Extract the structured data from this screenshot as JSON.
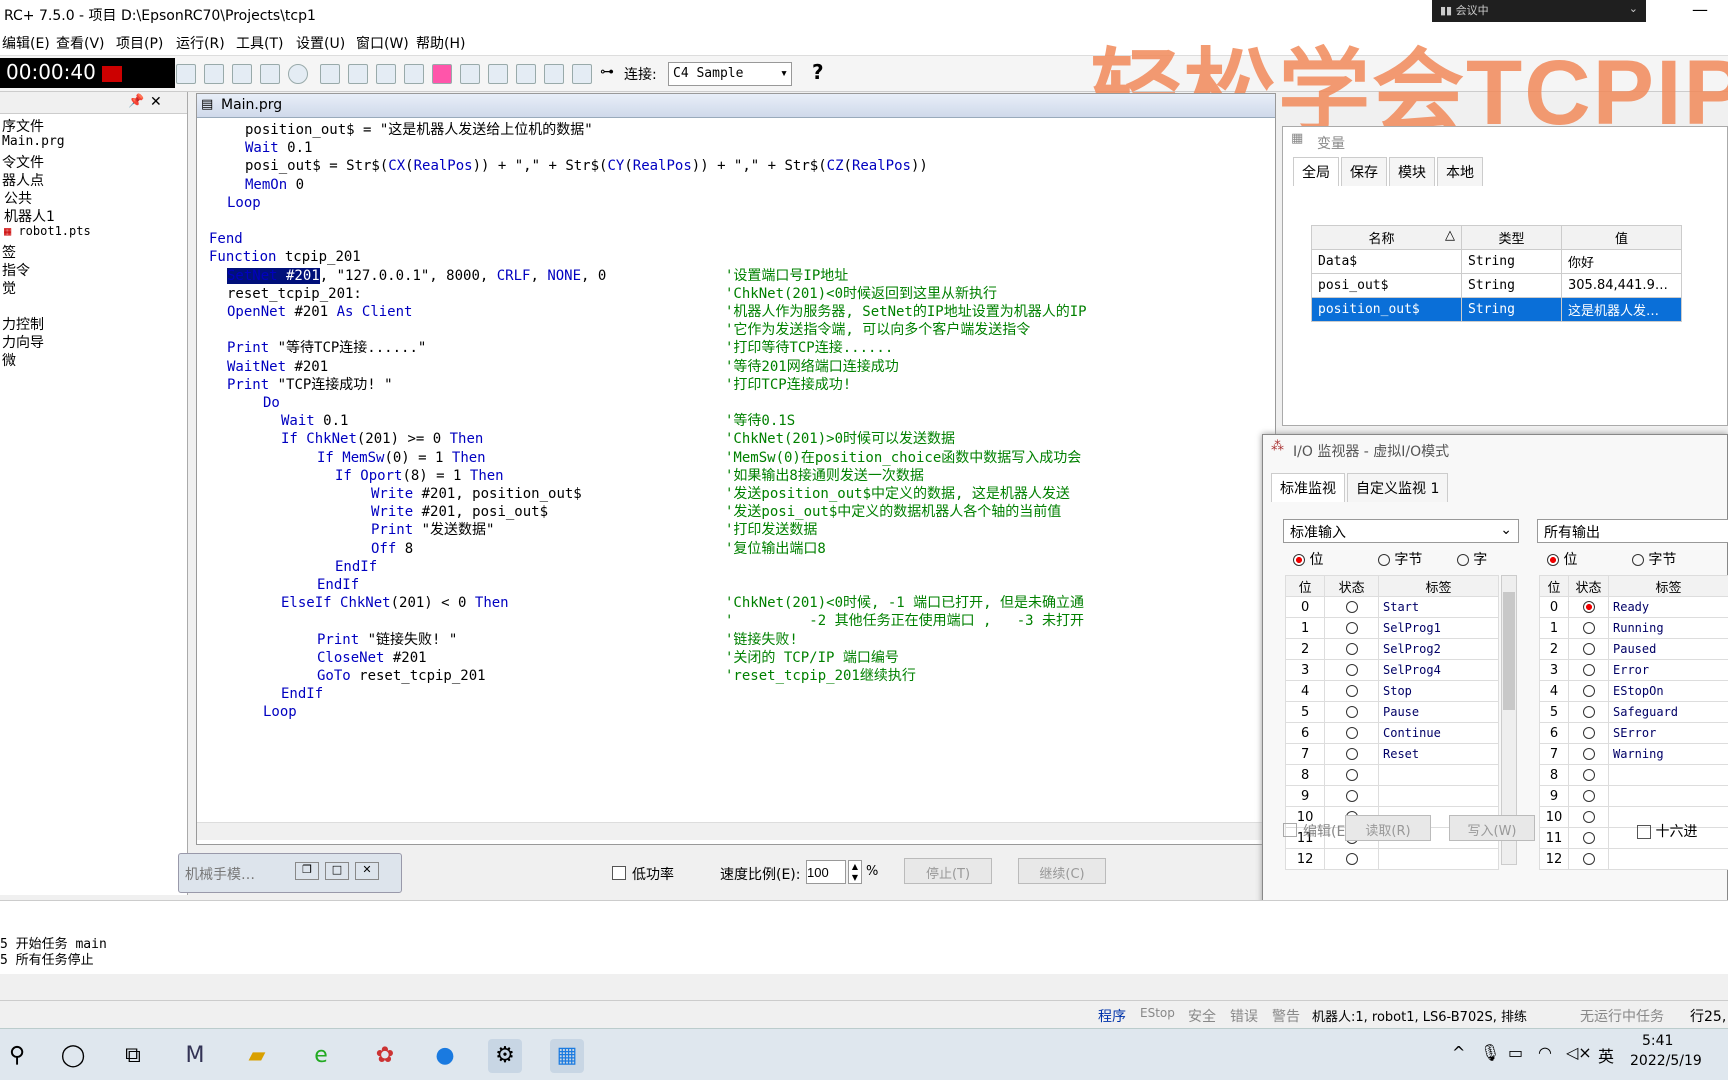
{
  "window": {
    "title": "RC+ 7.5.0 - 项目 D:\\EpsonRC70\\Projects\\tcp1",
    "timer": "00:00:40",
    "meeting": "会议中",
    "minimize": "—"
  },
  "watermark": "轻松学会TCPIP",
  "menu": [
    "编辑(E)",
    "查看(V)",
    "项目(P)",
    "运行(R)",
    "工具(T)",
    "设置(U)",
    "窗口(W)",
    "帮助(H)"
  ],
  "toolbar": {
    "connect_label": "连接:",
    "connect_value": "C4 Sample",
    "help": "?"
  },
  "project_tree": {
    "pin": "📌",
    "close": "✕",
    "items": [
      "序文件",
      "Main.prg",
      "令文件",
      "器人点",
      "公共",
      "机器人1",
      "robot1.pts",
      "签",
      "指令",
      "觉",
      "",
      "力控制",
      "力向导",
      "微"
    ]
  },
  "editor": {
    "tab": "Main.prg",
    "lines": [
      {
        "i": 1,
        "t": "position_out$ = \"这是机器人发送给上位机的数据\"",
        "c": ""
      },
      {
        "i": 1,
        "t": "Wait 0.1",
        "c": ""
      },
      {
        "i": 1,
        "t": "posi_out$ = Str$(CX(RealPos)) + \",\" + Str$(CY(RealPos)) + \",\" + Str$(CZ(RealPos))",
        "c": ""
      },
      {
        "i": 1,
        "t": "MemOn 0",
        "c": ""
      },
      {
        "i": 0.5,
        "t": "Loop",
        "c": ""
      },
      {
        "i": 0,
        "t": "",
        "c": ""
      },
      {
        "i": 0,
        "t": "Fend",
        "c": ""
      },
      {
        "i": 0,
        "t": "Function tcpip_201",
        "c": ""
      },
      {
        "i": 0.5,
        "t": "SetNet #201, \"127.0.0.1\", 8000, CRLF, NONE, 0",
        "c": "'设置端口号IP地址"
      },
      {
        "i": 0.5,
        "t": "reset_tcpip_201:",
        "c": "'ChkNet(201)<0时候返回到这里从新执行"
      },
      {
        "i": 0.5,
        "t": "OpenNet #201 As Client",
        "c": "'机器人作为服务器, SetNet的IP地址设置为机器人的IP"
      },
      {
        "i": 0,
        "t": "",
        "c": "'它作为发送指令端, 可以向多个客户端发送指令"
      },
      {
        "i": 0.5,
        "t": "Print \"等待TCP连接......\"",
        "c": "'打印等待TCP连接......"
      },
      {
        "i": 0.5,
        "t": "WaitNet #201",
        "c": "'等待201网络端口连接成功"
      },
      {
        "i": 0.5,
        "t": "Print \"TCP连接成功! \"",
        "c": "'打印TCP连接成功!"
      },
      {
        "i": 1.5,
        "t": "Do",
        "c": ""
      },
      {
        "i": 2,
        "t": "Wait 0.1",
        "c": "'等待0.1S"
      },
      {
        "i": 2,
        "t": "If ChkNet(201) >= 0 Then",
        "c": "'ChkNet(201)>0时候可以发送数据"
      },
      {
        "i": 3,
        "t": "If MemSw(0) = 1 Then",
        "c": "'MemSw(0)在position_choice函数中数据写入成功会"
      },
      {
        "i": 3.5,
        "t": "If Oport(8) = 1 Then",
        "c": "'如果输出8接通则发送一次数据"
      },
      {
        "i": 4.5,
        "t": "Write #201, position_out$",
        "c": "'发送position_out$中定义的数据, 这是机器人发送"
      },
      {
        "i": 4.5,
        "t": "Write #201, posi_out$",
        "c": "'发送posi_out$中定义的数据机器人各个轴的当前值"
      },
      {
        "i": 4.5,
        "t": "Print \"发送数据\"",
        "c": "'打印发送数据"
      },
      {
        "i": 4.5,
        "t": "Off 8",
        "c": "'复位输出端口8"
      },
      {
        "i": 3.5,
        "t": "EndIf",
        "c": ""
      },
      {
        "i": 3,
        "t": "EndIf",
        "c": ""
      },
      {
        "i": 2,
        "t": "ElseIf ChkNet(201) < 0 Then",
        "c": "'ChkNet(201)<0时候, -1 端口已打开, 但是未确立通"
      },
      {
        "i": 0,
        "t": "",
        "c": "'         -2 其他任务正在使用端口 ,   -3 未打开"
      },
      {
        "i": 3,
        "t": "Print \"链接失败! \"",
        "c": "'链接失败!"
      },
      {
        "i": 3,
        "t": "CloseNet #201",
        "c": "'关闭的 TCP/IP 端口编号"
      },
      {
        "i": 3,
        "t": "GoTo reset_tcpip_201",
        "c": "'reset_tcpip_201继续执行"
      },
      {
        "i": 2,
        "t": "EndIf",
        "c": ""
      },
      {
        "i": 1.5,
        "t": "Loop",
        "c": ""
      }
    ]
  },
  "robot_panel": {
    "title": "机械手模…",
    "low_power": "低功率",
    "speed_label": "速度比例(E):",
    "speed_value": "100",
    "speed_unit": "%",
    "stop": "停止(T)",
    "continue": "继续(C)"
  },
  "variables": {
    "title": "变量",
    "tabs": [
      "全局",
      "保存",
      "模块",
      "本地"
    ],
    "headers": [
      "名称",
      "类型",
      "值"
    ],
    "rows": [
      {
        "name": "Data$",
        "type": "String",
        "value": "你好"
      },
      {
        "name": "posi_out$",
        "type": "String",
        "value": "305.84,441.9…"
      },
      {
        "name": "position_out$",
        "type": "String",
        "value": "这是机器人发…"
      }
    ]
  },
  "io_monitor": {
    "title": "I/O 监视器 - 虚拟I/O模式",
    "tabs": [
      "标准监视",
      "自定义监视 1"
    ],
    "input_select": "标准输入",
    "output_select": "所有输出",
    "radio": [
      "位",
      "字节",
      "字"
    ],
    "headers": [
      "位",
      "状态",
      "标签"
    ],
    "inputs": [
      "Start",
      "SelProg1",
      "SelProg2",
      "SelProg4",
      "Stop",
      "Pause",
      "Continue",
      "Reset",
      "",
      "",
      "",
      "",
      ""
    ],
    "outputs": [
      "Ready",
      "Running",
      "Paused",
      "Error",
      "EStopOn",
      "Safeguard",
      "SError",
      "Warning",
      "",
      "",
      "",
      "",
      ""
    ],
    "edit": "编辑(E)",
    "read": "读取(R)",
    "write": "写入(W)",
    "hex": "十六进"
  },
  "log": [
    "5 开始任务 main",
    "5 所有任务停止"
  ],
  "status": [
    "程序",
    "EStop",
    "安全",
    "错误",
    "警告",
    "机器人:1, robot1, LS6-B702S, 排练",
    "无运行中任务",
    "行25,"
  ],
  "tray": {
    "time": "5:41",
    "date": "2022/5/19",
    "ime": "英"
  }
}
